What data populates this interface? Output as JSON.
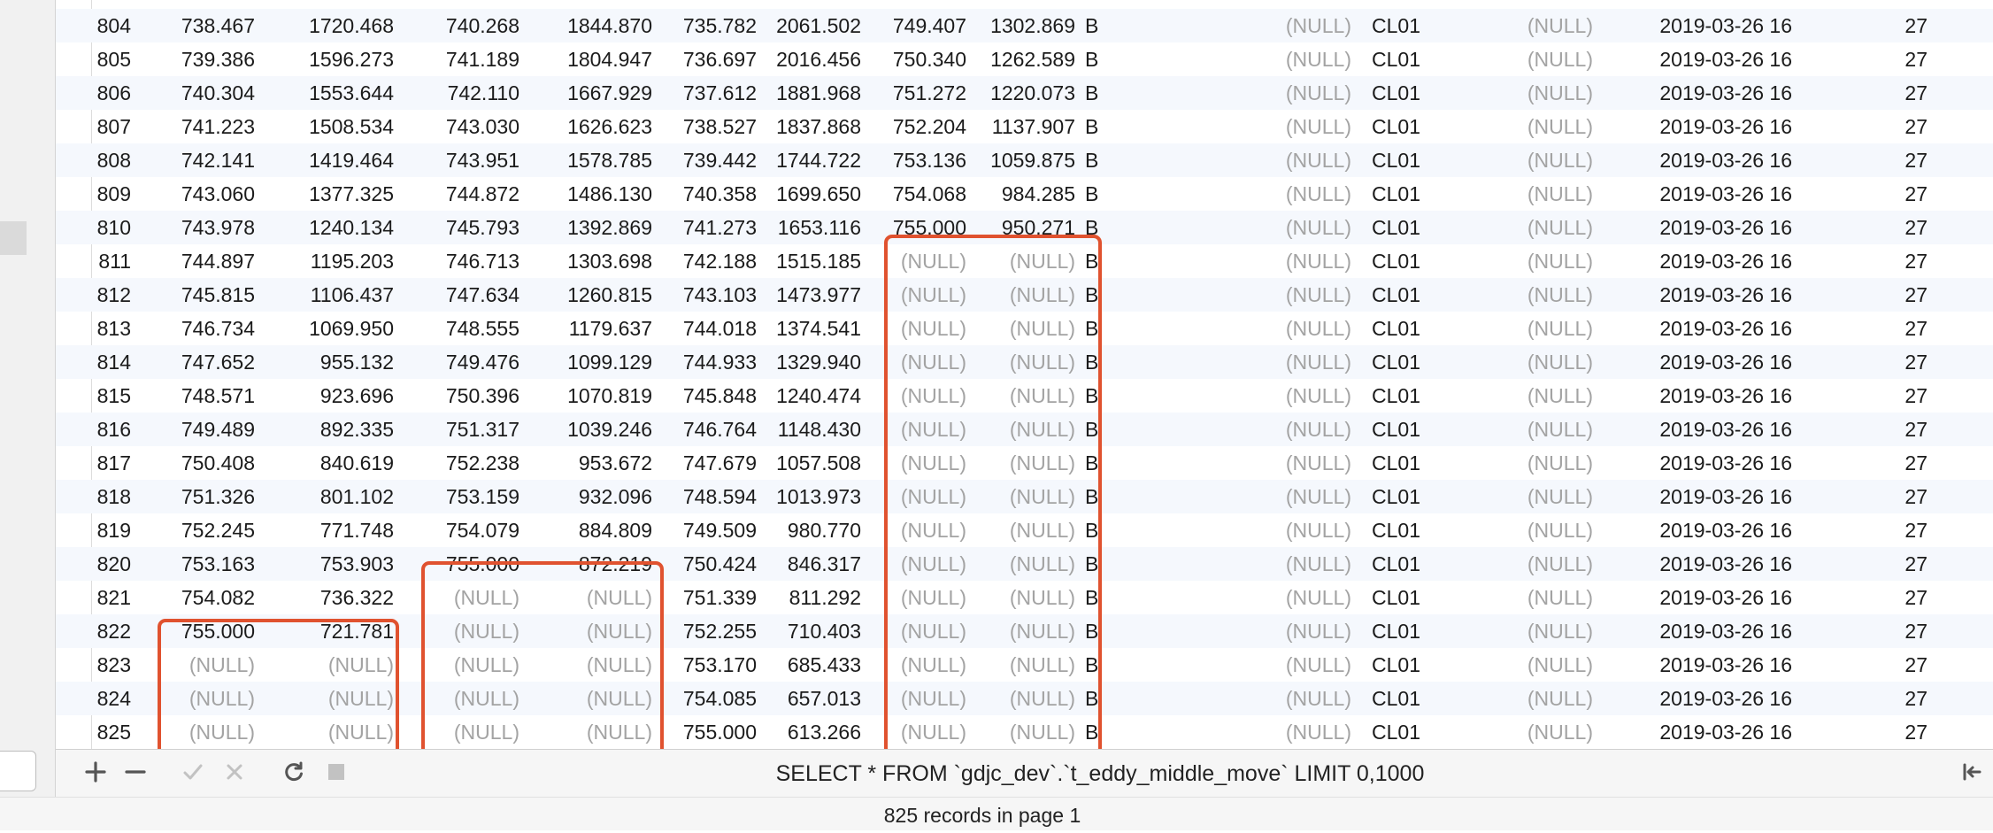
{
  "grid": {
    "rows": [
      [
        "804",
        "738.467",
        "1720.468",
        "740.268",
        "1844.870",
        "735.782",
        "2061.502",
        "749.407",
        "1302.869",
        "B",
        "(NULL)",
        "CL01",
        "(NULL)",
        "2019-03-26 16",
        "27"
      ],
      [
        "805",
        "739.386",
        "1596.273",
        "741.189",
        "1804.947",
        "736.697",
        "2016.456",
        "750.340",
        "1262.589",
        "B",
        "(NULL)",
        "CL01",
        "(NULL)",
        "2019-03-26 16",
        "27"
      ],
      [
        "806",
        "740.304",
        "1553.644",
        "742.110",
        "1667.929",
        "737.612",
        "1881.968",
        "751.272",
        "1220.073",
        "B",
        "(NULL)",
        "CL01",
        "(NULL)",
        "2019-03-26 16",
        "27"
      ],
      [
        "807",
        "741.223",
        "1508.534",
        "743.030",
        "1626.623",
        "738.527",
        "1837.868",
        "752.204",
        "1137.907",
        "B",
        "(NULL)",
        "CL01",
        "(NULL)",
        "2019-03-26 16",
        "27"
      ],
      [
        "808",
        "742.141",
        "1419.464",
        "743.951",
        "1578.785",
        "739.442",
        "1744.722",
        "753.136",
        "1059.875",
        "B",
        "(NULL)",
        "CL01",
        "(NULL)",
        "2019-03-26 16",
        "27"
      ],
      [
        "809",
        "743.060",
        "1377.325",
        "744.872",
        "1486.130",
        "740.358",
        "1699.650",
        "754.068",
        "984.285",
        "B",
        "(NULL)",
        "CL01",
        "(NULL)",
        "2019-03-26 16",
        "27"
      ],
      [
        "810",
        "743.978",
        "1240.134",
        "745.793",
        "1392.869",
        "741.273",
        "1653.116",
        "755.000",
        "950.271",
        "B",
        "(NULL)",
        "CL01",
        "(NULL)",
        "2019-03-26 16",
        "27"
      ],
      [
        "811",
        "744.897",
        "1195.203",
        "746.713",
        "1303.698",
        "742.188",
        "1515.185",
        "(NULL)",
        "(NULL)",
        "B",
        "(NULL)",
        "CL01",
        "(NULL)",
        "2019-03-26 16",
        "27"
      ],
      [
        "812",
        "745.815",
        "1106.437",
        "747.634",
        "1260.815",
        "743.103",
        "1473.977",
        "(NULL)",
        "(NULL)",
        "B",
        "(NULL)",
        "CL01",
        "(NULL)",
        "2019-03-26 16",
        "27"
      ],
      [
        "813",
        "746.734",
        "1069.950",
        "748.555",
        "1179.637",
        "744.018",
        "1374.541",
        "(NULL)",
        "(NULL)",
        "B",
        "(NULL)",
        "CL01",
        "(NULL)",
        "2019-03-26 16",
        "27"
      ],
      [
        "814",
        "747.652",
        "955.132",
        "749.476",
        "1099.129",
        "744.933",
        "1329.940",
        "(NULL)",
        "(NULL)",
        "B",
        "(NULL)",
        "CL01",
        "(NULL)",
        "2019-03-26 16",
        "27"
      ],
      [
        "815",
        "748.571",
        "923.696",
        "750.396",
        "1070.819",
        "745.848",
        "1240.474",
        "(NULL)",
        "(NULL)",
        "B",
        "(NULL)",
        "CL01",
        "(NULL)",
        "2019-03-26 16",
        "27"
      ],
      [
        "816",
        "749.489",
        "892.335",
        "751.317",
        "1039.246",
        "746.764",
        "1148.430",
        "(NULL)",
        "(NULL)",
        "B",
        "(NULL)",
        "CL01",
        "(NULL)",
        "2019-03-26 16",
        "27"
      ],
      [
        "817",
        "750.408",
        "840.619",
        "752.238",
        "953.672",
        "747.679",
        "1057.508",
        "(NULL)",
        "(NULL)",
        "B",
        "(NULL)",
        "CL01",
        "(NULL)",
        "2019-03-26 16",
        "27"
      ],
      [
        "818",
        "751.326",
        "801.102",
        "753.159",
        "932.096",
        "748.594",
        "1013.973",
        "(NULL)",
        "(NULL)",
        "B",
        "(NULL)",
        "CL01",
        "(NULL)",
        "2019-03-26 16",
        "27"
      ],
      [
        "819",
        "752.245",
        "771.748",
        "754.079",
        "884.809",
        "749.509",
        "980.770",
        "(NULL)",
        "(NULL)",
        "B",
        "(NULL)",
        "CL01",
        "(NULL)",
        "2019-03-26 16",
        "27"
      ],
      [
        "820",
        "753.163",
        "753.903",
        "755.000",
        "872.219",
        "750.424",
        "846.317",
        "(NULL)",
        "(NULL)",
        "B",
        "(NULL)",
        "CL01",
        "(NULL)",
        "2019-03-26 16",
        "27"
      ],
      [
        "821",
        "754.082",
        "736.322",
        "(NULL)",
        "(NULL)",
        "751.339",
        "811.292",
        "(NULL)",
        "(NULL)",
        "B",
        "(NULL)",
        "CL01",
        "(NULL)",
        "2019-03-26 16",
        "27"
      ],
      [
        "822",
        "755.000",
        "721.781",
        "(NULL)",
        "(NULL)",
        "752.255",
        "710.403",
        "(NULL)",
        "(NULL)",
        "B",
        "(NULL)",
        "CL01",
        "(NULL)",
        "2019-03-26 16",
        "27"
      ],
      [
        "823",
        "(NULL)",
        "(NULL)",
        "(NULL)",
        "(NULL)",
        "753.170",
        "685.433",
        "(NULL)",
        "(NULL)",
        "B",
        "(NULL)",
        "CL01",
        "(NULL)",
        "2019-03-26 16",
        "27"
      ],
      [
        "824",
        "(NULL)",
        "(NULL)",
        "(NULL)",
        "(NULL)",
        "754.085",
        "657.013",
        "(NULL)",
        "(NULL)",
        "B",
        "(NULL)",
        "CL01",
        "(NULL)",
        "2019-03-26 16",
        "27"
      ],
      [
        "825",
        "(NULL)",
        "(NULL)",
        "(NULL)",
        "(NULL)",
        "755.000",
        "613.266",
        "(NULL)",
        "(NULL)",
        "B",
        "(NULL)",
        "CL01",
        "(NULL)",
        "2019-03-26 16",
        "27"
      ]
    ]
  },
  "toolbar": {
    "add_icon": "plus-icon",
    "remove_icon": "minus-icon",
    "apply_icon": "checkmark-icon",
    "discard_icon": "x-icon",
    "refresh_icon": "refresh-icon",
    "stop_icon": "stop-icon",
    "first_page_icon": "first-page-icon",
    "sql": "SELECT * FROM `gdjc_dev`.`t_eddy_middle_move` LIMIT 0,1000"
  },
  "status": {
    "records": "825 records in page 1"
  },
  "colors": {
    "highlight": "#e0522f",
    "row_alt": "#f5f8fd",
    "null_text": "#a3a3a3"
  }
}
